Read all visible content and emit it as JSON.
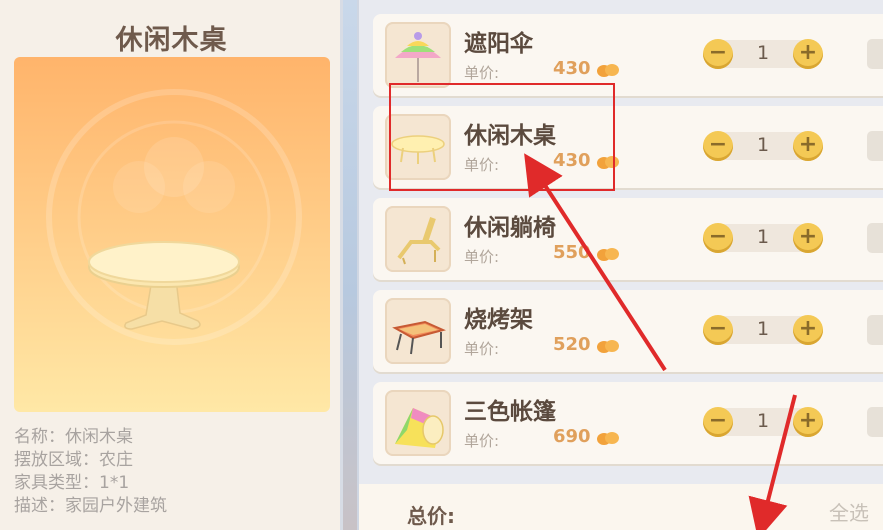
{
  "detail": {
    "title": "休闲木桌",
    "info": [
      "名称：休闲木桌",
      "摆放区域：农庄",
      "家具类型：1*1",
      "描述：家园户外建筑"
    ]
  },
  "list": {
    "items": [
      {
        "name": "遮阳伞",
        "price_label": "单价:",
        "price": "430",
        "qty": "1",
        "minus": "−",
        "plus": "+",
        "icon": "parasol-icon"
      },
      {
        "name": "休闲木桌",
        "price_label": "单价:",
        "price": "430",
        "qty": "1",
        "minus": "−",
        "plus": "+",
        "icon": "wooden-table-icon"
      },
      {
        "name": "休闲躺椅",
        "price_label": "单价:",
        "price": "550",
        "qty": "1",
        "minus": "−",
        "plus": "+",
        "icon": "lounge-chair-icon"
      },
      {
        "name": "烧烤架",
        "price_label": "单价:",
        "price": "520",
        "qty": "1",
        "minus": "−",
        "plus": "+",
        "icon": "bbq-grill-icon"
      },
      {
        "name": "三色帐篷",
        "price_label": "单价:",
        "price": "690",
        "qty": "1",
        "minus": "−",
        "plus": "+",
        "icon": "tent-icon"
      }
    ],
    "total_label": "总价:",
    "select_all": "全选"
  },
  "colors": {
    "price": "#e0a05c",
    "button": "#f4c955",
    "highlight": "#e02a2a"
  }
}
